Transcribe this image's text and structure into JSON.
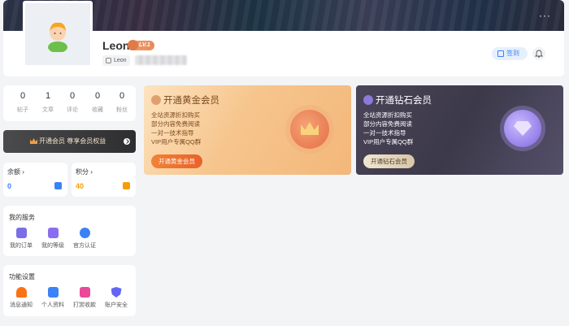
{
  "header": {
    "more_label": "···",
    "user_name": "Leon",
    "level_badge": "LV.1",
    "user_tag": "Leon",
    "checkin_label": "签到"
  },
  "stats": [
    {
      "value": "0",
      "label": "帖子"
    },
    {
      "value": "1",
      "label": "文章"
    },
    {
      "value": "0",
      "label": "评论"
    },
    {
      "value": "0",
      "label": "收藏"
    },
    {
      "value": "0",
      "label": "粉丝"
    }
  ],
  "vip_bar": {
    "label": "开通会员 尊享会员权益"
  },
  "balance": {
    "title": "余额 ›",
    "value": "0",
    "value_color": "#3b82f6"
  },
  "points": {
    "title": "积分 ›",
    "value": "40",
    "value_color": "#f59e0b"
  },
  "services": {
    "title": "我的服务",
    "items": [
      {
        "label": "我的订单",
        "icon": "order-icon",
        "color": "#7c6ee6"
      },
      {
        "label": "我的等级",
        "icon": "level-icon",
        "color": "#8a6ef0"
      },
      {
        "label": "官方认证",
        "icon": "verified-icon",
        "color": "#3b82f6"
      }
    ]
  },
  "settings": {
    "title": "功能设置",
    "items": [
      {
        "label": "消息通知",
        "icon": "bell-icon",
        "color": "#f97316"
      },
      {
        "label": "个人资料",
        "icon": "user-card-icon",
        "color": "#3b82f6"
      },
      {
        "label": "打赏收款",
        "icon": "gift-icon",
        "color": "#ec4899"
      },
      {
        "label": "账户安全",
        "icon": "shield-icon",
        "color": "#6366f1"
      }
    ]
  },
  "gold_card": {
    "title": "开通黄金会员",
    "features": [
      "全站资源折扣购买",
      "部分内容免费阅读",
      "一对一技术指导",
      "VIP用户专属QQ群"
    ],
    "button": "开通黄金会员"
  },
  "diamond_card": {
    "title": "开通钻石会员",
    "features": [
      "全站资源折扣购买",
      "部分内容免费阅读",
      "一对一技术指导",
      "VIP用户专属QQ群"
    ],
    "button": "开通钻石会员"
  }
}
